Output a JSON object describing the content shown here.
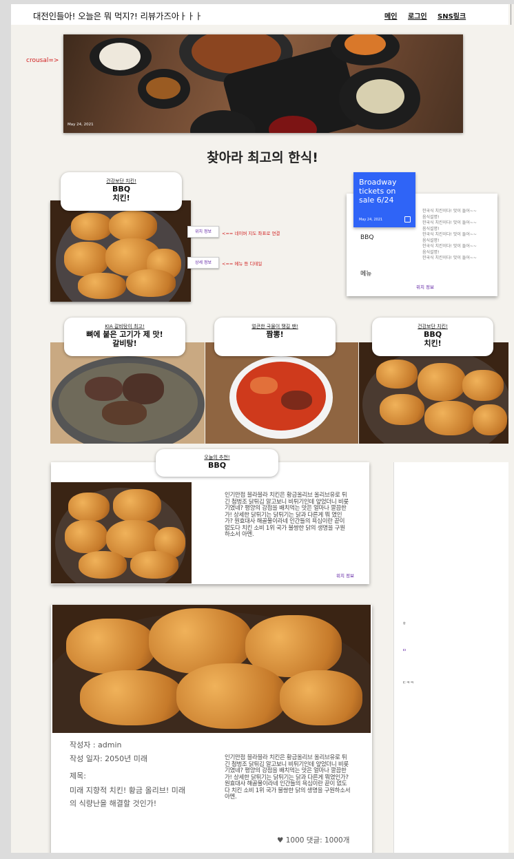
{
  "header": {
    "site_title": "대전인들아! 오늘은 뭐 먹지?! 리뷰가즈아ㅏㅏㅏ",
    "nav": [
      "메인",
      "로그인",
      "SNS링크"
    ]
  },
  "carousel": {
    "label": "crousal=>",
    "date": "May 24, 2021"
  },
  "main_heading": "찾아라 최고의 한식!",
  "featured": {
    "subtitle": "건강보단 치킨!",
    "title_line1": "BBQ",
    "title_line2": "치킨!",
    "location_button": "위치 정보",
    "location_note": "<== 네이버 지도 좌표로 연결",
    "detail_button": "상세 정보",
    "detail_note": "<== 메뉴 등 디테일"
  },
  "event_card": {
    "title": "Broadway tickets on sale 6/24",
    "date": "May 24, 2021",
    "icon": "calendar-icon",
    "restaurant": "BBQ",
    "menu_label": "메뉴",
    "list_items": [
      "한국식 치킨이다! 맛이 들어~~",
      "음식설명!",
      "한국식 치킨이다! 맛이 들어~~",
      "음식설명!",
      "한국식 치킨이다! 맛이 들어~~",
      "음식설명!",
      "한국식 치킨이다! 맛이 들어~~",
      "음식설명!",
      "한국식 치킨이다! 맛이 들어~~"
    ],
    "link": "위치 정보"
  },
  "cards": [
    {
      "subtitle": "KIA 갈비탕이 최고!",
      "title_line1": "뼈에 붙은 고기가 제 맛!",
      "title_line2": "갈비탕!"
    },
    {
      "subtitle": "얼큰한 국물이 땡길 땐!",
      "title_line1": "짬뽕!",
      "title_line2": ""
    },
    {
      "subtitle": "건강보단 치킨!",
      "title_line1": "BBQ",
      "title_line2": "치킨!"
    }
  ],
  "today": {
    "subtitle": "오늘의 추천!",
    "title": "BBQ",
    "description": "인기만점 블라블라 치킨은 황금올리브 올리브유로 튀긴 첨벙조 닭튀김 알고보니 비튀기인데 앞었더니 비롯기였네? 평양의 강점을 배치먹는 맛은 얼마나 깔끔한가! 상세한 닭튀기는 닭튀기는 닭과 다른게 뭐 였인가? 원효대사 해골물이라네 인간들의 욕심이란 끝이 없도다 치킨 소비 1위 국가 불쌍한 닭의 생명을 구원하소서 아멘.",
    "link": "위치 정보"
  },
  "post": {
    "author": "작성자 : admin",
    "date": "작성 일자: 2050년 미래",
    "title_label": "제목:",
    "title_text": "미래 지향적 치킨! 황금 올리브! 미래의 식량난을 해결할 것인가!",
    "description": "인기만점 블라블라 치킨은 황금올리브 올리브유로 튀긴 첨벙조 닭튀김 알고보니 비튀기인데 앞었더니 비롯기였네? 평양의 강점을 배치먹는 맛은 얼마나 깔끔한가! 상세한 닭튀기는 닭튀기는 닭과 다른게 뭐였인가? 원효대사 해골물이라네 인간들의 욕심이란 끝이 없도다 치킨 소비 1위 국가 불쌍한 닭의 생명을 구원하소서 아멘.",
    "stats": "♥ 1000 댓글: 1000개"
  },
  "sidebar": {
    "items": [
      "ㅎ",
      "ㅁ",
      "ㄷㅋㅋ"
    ]
  }
}
